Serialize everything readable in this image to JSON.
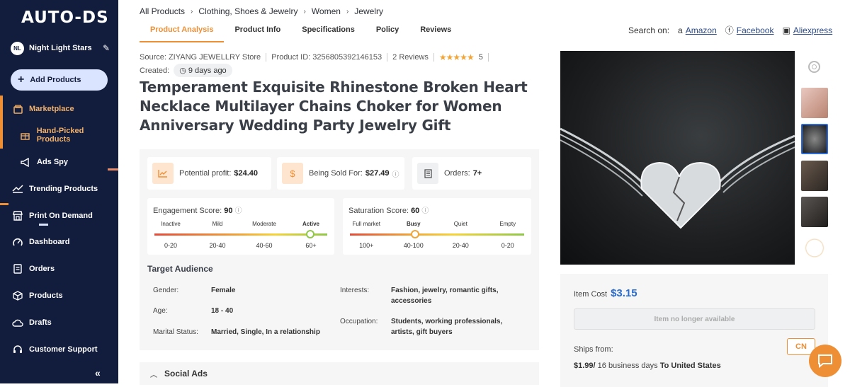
{
  "sidebar": {
    "logo": "AUTO-DS",
    "user": {
      "initials": "NL",
      "name": "Night Light Stars"
    },
    "add_button": "Add Products",
    "items": [
      {
        "label": "Marketplace",
        "icon": "store-icon"
      },
      {
        "label": "Hand-Picked Products",
        "icon": "gift-icon"
      },
      {
        "label": "Ads Spy",
        "icon": "megaphone-icon"
      },
      {
        "label": "Trending Products",
        "icon": "trending-icon"
      },
      {
        "label": "Print On Demand",
        "icon": "print-shop-icon"
      },
      {
        "label": "Dashboard",
        "icon": "gauge-icon"
      },
      {
        "label": "Orders",
        "icon": "orders-icon"
      },
      {
        "label": "Products",
        "icon": "box-icon"
      },
      {
        "label": "Drafts",
        "icon": "cloud-upload-icon"
      },
      {
        "label": "Customer Support",
        "icon": "headset-icon"
      }
    ],
    "collapse": "«"
  },
  "breadcrumb": [
    "All Products",
    "Clothing, Shoes & Jewelry",
    "Women",
    "Jewelry"
  ],
  "tabs": [
    "Product Analysis",
    "Product Info",
    "Specifications",
    "Policy",
    "Reviews"
  ],
  "search_on": {
    "label": "Search on:",
    "links": [
      "Amazon",
      "Facebook",
      "Aliexpress"
    ]
  },
  "meta": {
    "source": "Source: ZIYANG JEWELLRY Store",
    "product_id": "Product ID: 3256805392146153",
    "reviews": "2 Reviews",
    "stars": "★★★★★",
    "rating": "5",
    "created_label": "Created:",
    "created_value": "9 days ago"
  },
  "title": "Temperament Exquisite Rhinestone Broken Heart Necklace Multilayer Chains Choker for Women Anniversary Wedding Party Jewelry Gift",
  "kpis": {
    "profit_label": "Potential profit:",
    "profit_value": "$24.40",
    "sold_label": "Being Sold For:",
    "sold_value": "$27.49",
    "orders_label": "Orders:",
    "orders_value": "7+"
  },
  "engagement": {
    "label": "Engagement Score:",
    "value": "90",
    "levels": [
      "Inactive",
      "Mild",
      "Moderate",
      "Active"
    ],
    "ranges": [
      "0-20",
      "20-40",
      "40-60",
      "60+"
    ],
    "active_index": 3,
    "level": 0.9
  },
  "saturation": {
    "label": "Saturation Score:",
    "value": "60",
    "levels": [
      "Full market",
      "Busy",
      "Quiet",
      "Empty"
    ],
    "ranges": [
      "100+",
      "40-100",
      "20-40",
      "0-20"
    ],
    "active_index": 1,
    "level": 0.375
  },
  "audience": {
    "title": "Target Audience",
    "gender_label": "Gender:",
    "gender": "Female",
    "age_label": "Age:",
    "age": "18 - 40",
    "marital_label": "Marital Status:",
    "marital": "Married, Single, In a relationship",
    "interests_label": "Interests:",
    "interests": "Fashion, jewelry, romantic gifts, accessories",
    "occupation_label": "Occupation:",
    "occupation": "Students, working professionals, artists, gift buyers"
  },
  "social_ads": "Social Ads",
  "purchase": {
    "cost_label": "Item Cost",
    "cost_value": "$3.15",
    "unavailable": "Item no longer available",
    "ships_from_label": "Ships from:",
    "ships_from_value": "CN",
    "shipping_price": "$1.99/",
    "shipping_days": " 16 business days ",
    "shipping_dest": "To United States"
  },
  "colors": {
    "accent": "#ef8f35",
    "sidebar": "#121d3e",
    "link": "#2a6bcf"
  }
}
